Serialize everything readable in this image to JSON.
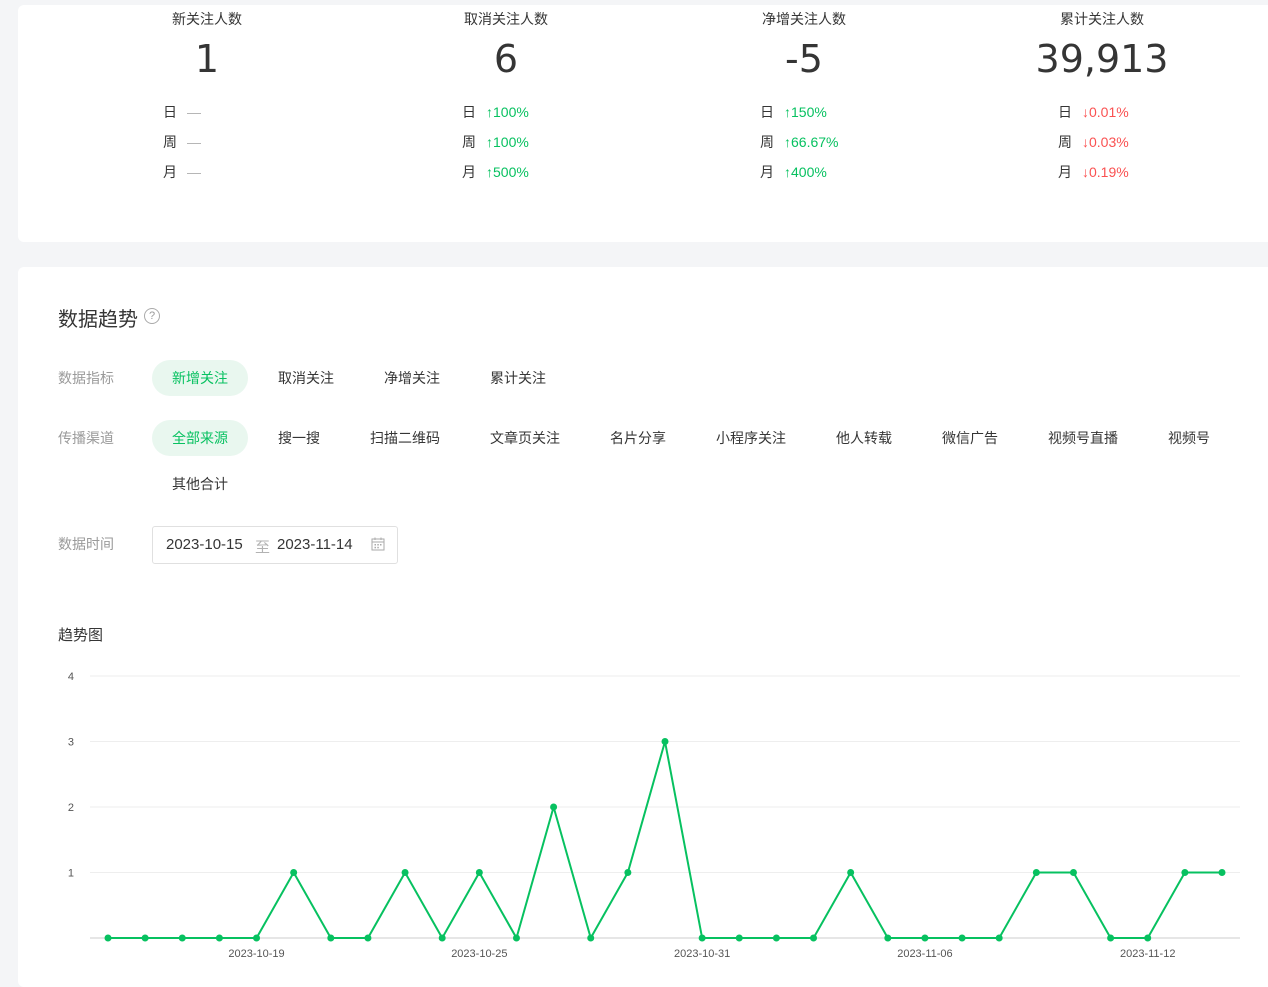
{
  "summary": {
    "cards": [
      {
        "title": "新关注人数",
        "value": "1",
        "rows": [
          {
            "label": "日",
            "arrow": "",
            "text": "—",
            "trend": "none"
          },
          {
            "label": "周",
            "arrow": "",
            "text": "—",
            "trend": "none"
          },
          {
            "label": "月",
            "arrow": "",
            "text": "—",
            "trend": "none"
          }
        ]
      },
      {
        "title": "取消关注人数",
        "value": "6",
        "rows": [
          {
            "label": "日",
            "arrow": "↑",
            "text": "100%",
            "trend": "up"
          },
          {
            "label": "周",
            "arrow": "↑",
            "text": "100%",
            "trend": "up"
          },
          {
            "label": "月",
            "arrow": "↑",
            "text": "500%",
            "trend": "up"
          }
        ]
      },
      {
        "title": "净增关注人数",
        "value": "-5",
        "rows": [
          {
            "label": "日",
            "arrow": "↑",
            "text": "150%",
            "trend": "up"
          },
          {
            "label": "周",
            "arrow": "↑",
            "text": "66.67%",
            "trend": "up"
          },
          {
            "label": "月",
            "arrow": "↑",
            "text": "400%",
            "trend": "up"
          }
        ]
      },
      {
        "title": "累计关注人数",
        "value": "39,913",
        "rows": [
          {
            "label": "日",
            "arrow": "↓",
            "text": "0.01%",
            "trend": "down"
          },
          {
            "label": "周",
            "arrow": "↓",
            "text": "0.03%",
            "trend": "down"
          },
          {
            "label": "月",
            "arrow": "↓",
            "text": "0.19%",
            "trend": "down"
          }
        ]
      }
    ]
  },
  "trend": {
    "title": "数据趋势",
    "help_icon": "question-circle-icon",
    "metric_label": "数据指标",
    "metrics": [
      "新增关注",
      "取消关注",
      "净增关注",
      "累计关注"
    ],
    "metric_selected": 0,
    "channel_label": "传播渠道",
    "channels": [
      "全部来源",
      "搜一搜",
      "扫描二维码",
      "文章页关注",
      "名片分享",
      "小程序关注",
      "他人转载",
      "微信广告",
      "视频号直播",
      "视频号",
      "其他合计"
    ],
    "channel_selected": 0,
    "date_label": "数据时间",
    "date_start": "2023-10-15",
    "date_sep": "至",
    "date_end": "2023-11-14",
    "calendar_icon": "calendar-icon",
    "chart_title": "趋势图"
  },
  "colors": {
    "accent": "#07c160",
    "down": "#fa5151",
    "neutral": "#b2b2b2"
  },
  "chart_data": {
    "type": "line",
    "title": "趋势图",
    "x": [
      "2023-10-15",
      "2023-10-16",
      "2023-10-17",
      "2023-10-18",
      "2023-10-19",
      "2023-10-20",
      "2023-10-21",
      "2023-10-22",
      "2023-10-23",
      "2023-10-24",
      "2023-10-25",
      "2023-10-26",
      "2023-10-27",
      "2023-10-28",
      "2023-10-29",
      "2023-10-30",
      "2023-10-31",
      "2023-11-01",
      "2023-11-02",
      "2023-11-03",
      "2023-11-04",
      "2023-11-05",
      "2023-11-06",
      "2023-11-07",
      "2023-11-08",
      "2023-11-09",
      "2023-11-10",
      "2023-11-11",
      "2023-11-12",
      "2023-11-13",
      "2023-11-14"
    ],
    "values": [
      0,
      0,
      0,
      0,
      0,
      1,
      0,
      0,
      1,
      0,
      1,
      0,
      2,
      0,
      1,
      3,
      0,
      0,
      0,
      0,
      1,
      0,
      0,
      0,
      0,
      1,
      1,
      0,
      0,
      1,
      1
    ],
    "xticks": [
      "2023-10-19",
      "2023-10-25",
      "2023-10-31",
      "2023-11-06",
      "2023-11-12"
    ],
    "yticks": [
      1,
      2,
      3,
      4
    ],
    "ylim": [
      0,
      4
    ],
    "grid": true,
    "color": "#07c160"
  }
}
